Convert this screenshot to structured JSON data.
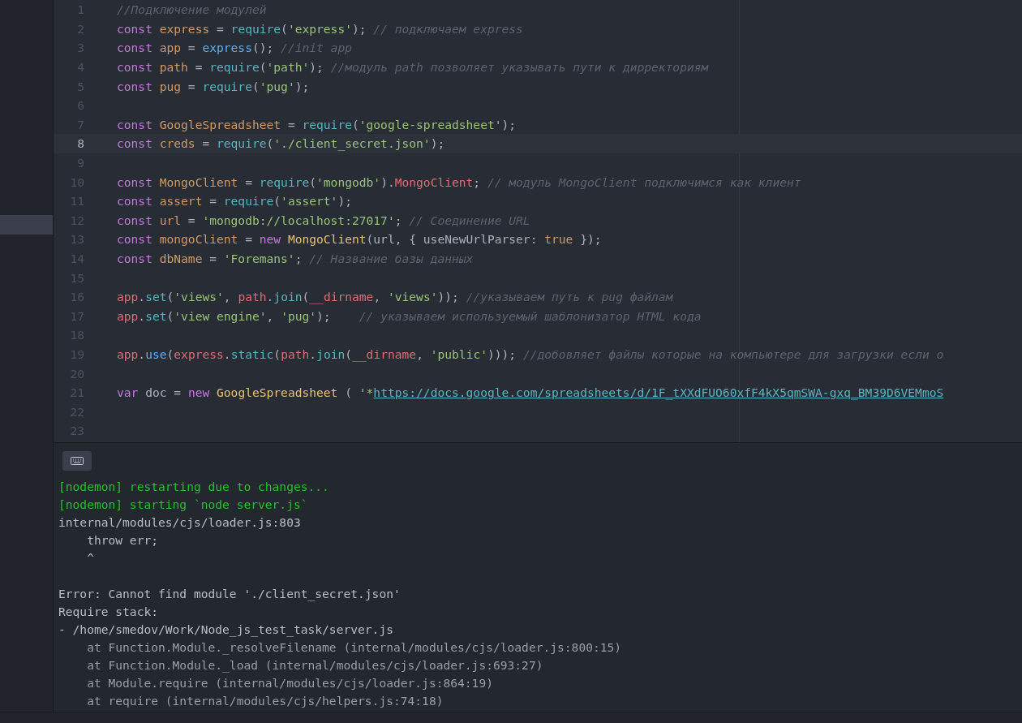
{
  "editor": {
    "lines": [
      {
        "number": "1",
        "current": false,
        "tokens": [
          {
            "kind": "cmt",
            "text": "//Подключение модулей"
          }
        ]
      },
      {
        "number": "2",
        "current": false,
        "tokens": [
          {
            "kind": "kw",
            "text": "const "
          },
          {
            "kind": "var",
            "text": "express"
          },
          {
            "kind": "punc",
            "text": " = "
          },
          {
            "kind": "fn",
            "text": "require"
          },
          {
            "kind": "punc",
            "text": "("
          },
          {
            "kind": "str",
            "text": "'express'"
          },
          {
            "kind": "punc",
            "text": "); "
          },
          {
            "kind": "cmt",
            "text": "// подключаем express"
          }
        ]
      },
      {
        "number": "3",
        "current": false,
        "tokens": [
          {
            "kind": "kw",
            "text": "const "
          },
          {
            "kind": "var",
            "text": "app"
          },
          {
            "kind": "punc",
            "text": " = "
          },
          {
            "kind": "call",
            "text": "express"
          },
          {
            "kind": "punc",
            "text": "(); "
          },
          {
            "kind": "cmt",
            "text": "//init app"
          }
        ]
      },
      {
        "number": "4",
        "current": false,
        "tokens": [
          {
            "kind": "kw",
            "text": "const "
          },
          {
            "kind": "var",
            "text": "path"
          },
          {
            "kind": "punc",
            "text": " = "
          },
          {
            "kind": "fn",
            "text": "require"
          },
          {
            "kind": "punc",
            "text": "("
          },
          {
            "kind": "str",
            "text": "'path'"
          },
          {
            "kind": "punc",
            "text": "); "
          },
          {
            "kind": "cmt",
            "text": "//модуль path позволяет указывать пути к дирректориям"
          }
        ]
      },
      {
        "number": "5",
        "current": false,
        "tokens": [
          {
            "kind": "kw",
            "text": "const "
          },
          {
            "kind": "var",
            "text": "pug"
          },
          {
            "kind": "punc",
            "text": " = "
          },
          {
            "kind": "fn",
            "text": "require"
          },
          {
            "kind": "punc",
            "text": "("
          },
          {
            "kind": "str",
            "text": "'pug'"
          },
          {
            "kind": "punc",
            "text": ");"
          }
        ]
      },
      {
        "number": "6",
        "current": false
      },
      {
        "number": "7",
        "current": false,
        "tokens": [
          {
            "kind": "kw",
            "text": "const "
          },
          {
            "kind": "var",
            "text": "GoogleSpreadsheet"
          },
          {
            "kind": "punc",
            "text": " = "
          },
          {
            "kind": "fn",
            "text": "require"
          },
          {
            "kind": "punc",
            "text": "("
          },
          {
            "kind": "str",
            "text": "'google-spreadsheet'"
          },
          {
            "kind": "punc",
            "text": ");"
          }
        ]
      },
      {
        "number": "8",
        "current": true,
        "tokens": [
          {
            "kind": "kw",
            "text": "const "
          },
          {
            "kind": "var",
            "text": "creds"
          },
          {
            "kind": "punc",
            "text": " = "
          },
          {
            "kind": "fn",
            "text": "require"
          },
          {
            "kind": "punc",
            "text": "("
          },
          {
            "kind": "str",
            "text": "'./client_secret.json'"
          },
          {
            "kind": "punc",
            "text": ");"
          }
        ]
      },
      {
        "number": "9",
        "current": false
      },
      {
        "number": "10",
        "current": false,
        "tokens": [
          {
            "kind": "kw",
            "text": "const "
          },
          {
            "kind": "var",
            "text": "MongoClient"
          },
          {
            "kind": "punc",
            "text": " = "
          },
          {
            "kind": "fn",
            "text": "require"
          },
          {
            "kind": "punc",
            "text": "("
          },
          {
            "kind": "str",
            "text": "'mongodb'"
          },
          {
            "kind": "punc",
            "text": ")."
          },
          {
            "kind": "red",
            "text": "MongoClient"
          },
          {
            "kind": "punc",
            "text": "; "
          },
          {
            "kind": "cmt",
            "text": "// модуль MongoClient подключимся как клиент"
          }
        ]
      },
      {
        "number": "11",
        "current": false,
        "tokens": [
          {
            "kind": "kw",
            "text": "const "
          },
          {
            "kind": "var",
            "text": "assert"
          },
          {
            "kind": "punc",
            "text": " = "
          },
          {
            "kind": "fn",
            "text": "require"
          },
          {
            "kind": "punc",
            "text": "("
          },
          {
            "kind": "str",
            "text": "'assert'"
          },
          {
            "kind": "punc",
            "text": ");"
          }
        ]
      },
      {
        "number": "12",
        "current": false,
        "tokens": [
          {
            "kind": "kw",
            "text": "const "
          },
          {
            "kind": "var",
            "text": "url"
          },
          {
            "kind": "punc",
            "text": " = "
          },
          {
            "kind": "str",
            "text": "'mongodb://localhost:27017'"
          },
          {
            "kind": "punc",
            "text": "; "
          },
          {
            "kind": "cmt",
            "text": "// Соединение URL"
          }
        ]
      },
      {
        "number": "13",
        "current": false,
        "tokens": [
          {
            "kind": "kw",
            "text": "const "
          },
          {
            "kind": "var",
            "text": "mongoClient"
          },
          {
            "kind": "punc",
            "text": " = "
          },
          {
            "kind": "kw",
            "text": "new "
          },
          {
            "kind": "cls",
            "text": "MongoClient"
          },
          {
            "kind": "punc",
            "text": "(url, { useNewUrlParser: "
          },
          {
            "kind": "num",
            "text": "true"
          },
          {
            "kind": "punc",
            "text": " });"
          }
        ]
      },
      {
        "number": "14",
        "current": false,
        "tokens": [
          {
            "kind": "kw",
            "text": "const "
          },
          {
            "kind": "var",
            "text": "dbName"
          },
          {
            "kind": "punc",
            "text": " = "
          },
          {
            "kind": "str",
            "text": "'Foremans'"
          },
          {
            "kind": "punc",
            "text": "; "
          },
          {
            "kind": "cmt",
            "text": "// Название базы данных"
          }
        ]
      },
      {
        "number": "15",
        "current": false
      },
      {
        "number": "16",
        "current": false,
        "tokens": [
          {
            "kind": "red",
            "text": "app"
          },
          {
            "kind": "punc",
            "text": "."
          },
          {
            "kind": "fn",
            "text": "set"
          },
          {
            "kind": "punc",
            "text": "("
          },
          {
            "kind": "str",
            "text": "'views'"
          },
          {
            "kind": "punc",
            "text": ", "
          },
          {
            "kind": "red",
            "text": "path"
          },
          {
            "kind": "punc",
            "text": "."
          },
          {
            "kind": "fn",
            "text": "join"
          },
          {
            "kind": "punc",
            "text": "("
          },
          {
            "kind": "red",
            "text": "__dirname"
          },
          {
            "kind": "punc",
            "text": ", "
          },
          {
            "kind": "str",
            "text": "'views'"
          },
          {
            "kind": "punc",
            "text": ")); "
          },
          {
            "kind": "cmt",
            "text": "//указываем путь к pug файлам"
          }
        ]
      },
      {
        "number": "17",
        "current": false,
        "tokens": [
          {
            "kind": "red",
            "text": "app"
          },
          {
            "kind": "punc",
            "text": "."
          },
          {
            "kind": "fn",
            "text": "set"
          },
          {
            "kind": "punc",
            "text": "("
          },
          {
            "kind": "str",
            "text": "'view engine'"
          },
          {
            "kind": "punc",
            "text": ", "
          },
          {
            "kind": "str",
            "text": "'pug'"
          },
          {
            "kind": "punc",
            "text": ");    "
          },
          {
            "kind": "cmt",
            "text": "// указываем используемый шаблонизатор HTML кода"
          }
        ]
      },
      {
        "number": "18",
        "current": false
      },
      {
        "number": "19",
        "current": false,
        "tokens": [
          {
            "kind": "red",
            "text": "app"
          },
          {
            "kind": "punc",
            "text": "."
          },
          {
            "kind": "call",
            "text": "use"
          },
          {
            "kind": "punc",
            "text": "("
          },
          {
            "kind": "red",
            "text": "express"
          },
          {
            "kind": "punc",
            "text": "."
          },
          {
            "kind": "fn",
            "text": "static"
          },
          {
            "kind": "punc",
            "text": "("
          },
          {
            "kind": "red",
            "text": "path"
          },
          {
            "kind": "punc",
            "text": "."
          },
          {
            "kind": "fn",
            "text": "join"
          },
          {
            "kind": "punc",
            "text": "("
          },
          {
            "kind": "red",
            "text": "__dirname"
          },
          {
            "kind": "punc",
            "text": ", "
          },
          {
            "kind": "str",
            "text": "'public'"
          },
          {
            "kind": "punc",
            "text": "))); "
          },
          {
            "kind": "cmt",
            "text": "//добовляет файлы которые на компьютере для загрузки если о"
          }
        ]
      },
      {
        "number": "20",
        "current": false
      },
      {
        "number": "21",
        "current": false,
        "tokens": [
          {
            "kind": "kw",
            "text": "var "
          },
          {
            "kind": "punc",
            "text": "doc = "
          },
          {
            "kind": "kw",
            "text": "new "
          },
          {
            "kind": "cls",
            "text": "GoogleSpreadsheet"
          },
          {
            "kind": "punc",
            "text": " ( "
          },
          {
            "kind": "str",
            "text": "'*"
          },
          {
            "kind": "link",
            "text": "https://docs.google.com/spreadsheets/d/1F_tXXdFUO60xfF4kX5qmSWA-gxq_BM39D6VEMmoS"
          }
        ]
      },
      {
        "number": "22",
        "current": false
      },
      {
        "number": "23",
        "current": false
      }
    ]
  },
  "terminal": {
    "lines": [
      {
        "kind": "nodemon",
        "text": "[nodemon] restarting due to changes..."
      },
      {
        "kind": "nodemon",
        "text": "[nodemon] starting `node server.js`"
      },
      {
        "kind": "plain",
        "text": "internal/modules/cjs/loader.js:803"
      },
      {
        "kind": "plain",
        "text": "    throw err;"
      },
      {
        "kind": "plain",
        "text": "    ^"
      },
      {
        "kind": "blank"
      },
      {
        "kind": "plain",
        "text": "Error: Cannot find module './client_secret.json'"
      },
      {
        "kind": "plain",
        "text": "Require stack:"
      },
      {
        "kind": "plain",
        "text": "- /home/smedov/Work/Node_js_test_task/server.js"
      },
      {
        "kind": "stack",
        "text": "    at Function.Module._resolveFilename (internal/modules/cjs/loader.js:800:15)"
      },
      {
        "kind": "stack",
        "text": "    at Function.Module._load (internal/modules/cjs/loader.js:693:27)"
      },
      {
        "kind": "stack",
        "text": "    at Module.require (internal/modules/cjs/loader.js:864:19)"
      },
      {
        "kind": "stack",
        "text": "    at require (internal/modules/cjs/helpers.js:74:18)"
      }
    ]
  }
}
